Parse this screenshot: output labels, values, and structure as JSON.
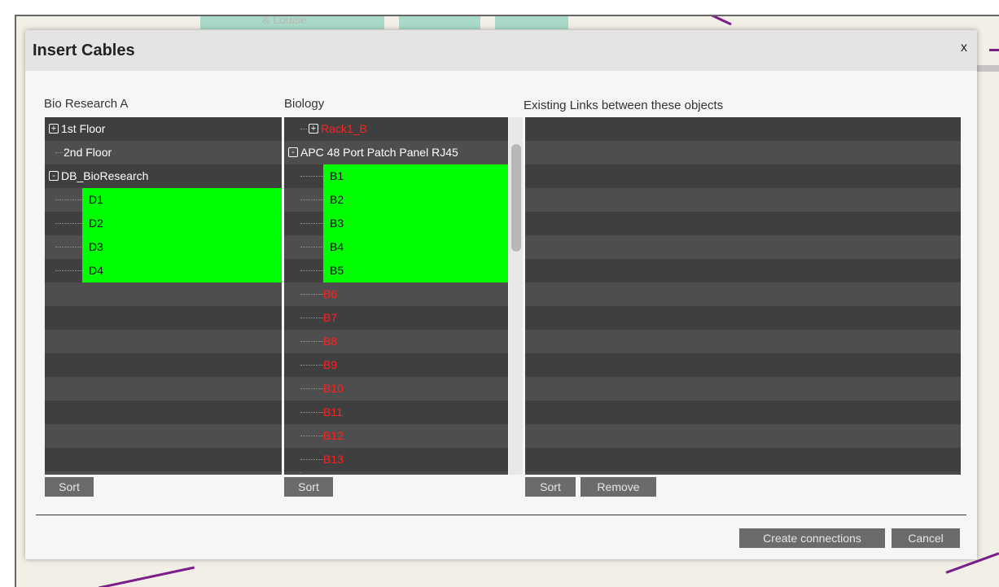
{
  "dialog": {
    "title": "Insert Cables",
    "close_label": "x"
  },
  "left": {
    "label": "Bio Research A",
    "items": [
      {
        "label": "1st Floor",
        "toggle": "+"
      },
      {
        "label": "2nd Floor"
      },
      {
        "label": "DB_BioResearch",
        "toggle": "-"
      },
      {
        "label": "D1"
      },
      {
        "label": "D2"
      },
      {
        "label": "D3"
      },
      {
        "label": "D4"
      }
    ],
    "sort_label": "Sort"
  },
  "middle": {
    "label": "Biology",
    "items": [
      {
        "label": "Rack1_B",
        "toggle": "+"
      },
      {
        "label": "APC 48 Port Patch Panel RJ45",
        "toggle": "-"
      },
      {
        "label": "B1"
      },
      {
        "label": "B2"
      },
      {
        "label": "B3"
      },
      {
        "label": "B4"
      },
      {
        "label": "B5"
      },
      {
        "label": "B6"
      },
      {
        "label": "B7"
      },
      {
        "label": "B8"
      },
      {
        "label": "B9"
      },
      {
        "label": "B10"
      },
      {
        "label": "B11"
      },
      {
        "label": "B12"
      },
      {
        "label": "B13"
      }
    ],
    "sort_label": "Sort"
  },
  "right": {
    "label": "Existing Links between these objects",
    "sort_label": "Sort",
    "remove_label": "Remove"
  },
  "footer": {
    "create_label": "Create connections",
    "cancel_label": "Cancel"
  },
  "background_map": {
    "street_text": "& Louise"
  },
  "colors": {
    "selected": "#00ff00",
    "unconnected_text": "#ff2020",
    "panel_dark": "#3f3f3f",
    "panel_light": "#4e4e4e",
    "button": "#6b6b6b"
  }
}
